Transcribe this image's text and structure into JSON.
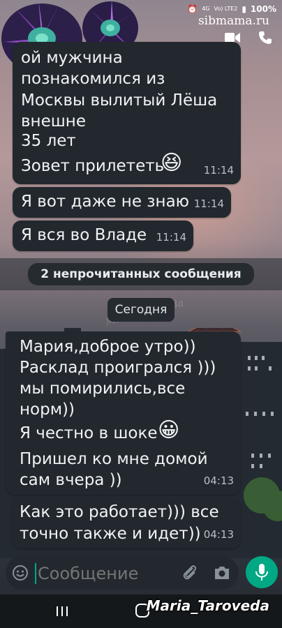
{
  "status_bar": {
    "indicators": "4G",
    "network": "Vo) LTE2",
    "battery": "100%"
  },
  "watermark_top": "sibmama.ru",
  "header": {
    "video_icon": "video-call-icon",
    "phone_icon": "voice-call-icon"
  },
  "messages": [
    {
      "lines": [
        "ой мужчина",
        "познакомился из",
        "Москвы вылитый Лёша",
        "внешне",
        "35 лет",
        "Зовет прилететь"
      ],
      "emoji": "😆",
      "time": "11:14"
    },
    {
      "text": "Я вот даже не знаю",
      "time": "11:14"
    },
    {
      "text": "Я вся во Владе",
      "time": "11:14"
    }
  ],
  "unread_banner": "2 непрочитанных сообщения",
  "date_chip": "Сегодня",
  "incoming": [
    {
      "lines": [
        "Мария,доброе утро))",
        "Расклад проигрался )))",
        "мы помирились,все",
        "норм))",
        "Я честно в шоке",
        "Пришел ко мне домой",
        "сам вчера ))"
      ],
      "emoji": "😀",
      "time": "04:13"
    },
    {
      "lines": [
        "Как это работает))) все",
        "точно также и идет))"
      ],
      "time": "04:13"
    }
  ],
  "input": {
    "placeholder": "Сообщение"
  },
  "signature": "Maria_Taroveda",
  "wallpaper_watermark": "Maria_Taroveda"
}
